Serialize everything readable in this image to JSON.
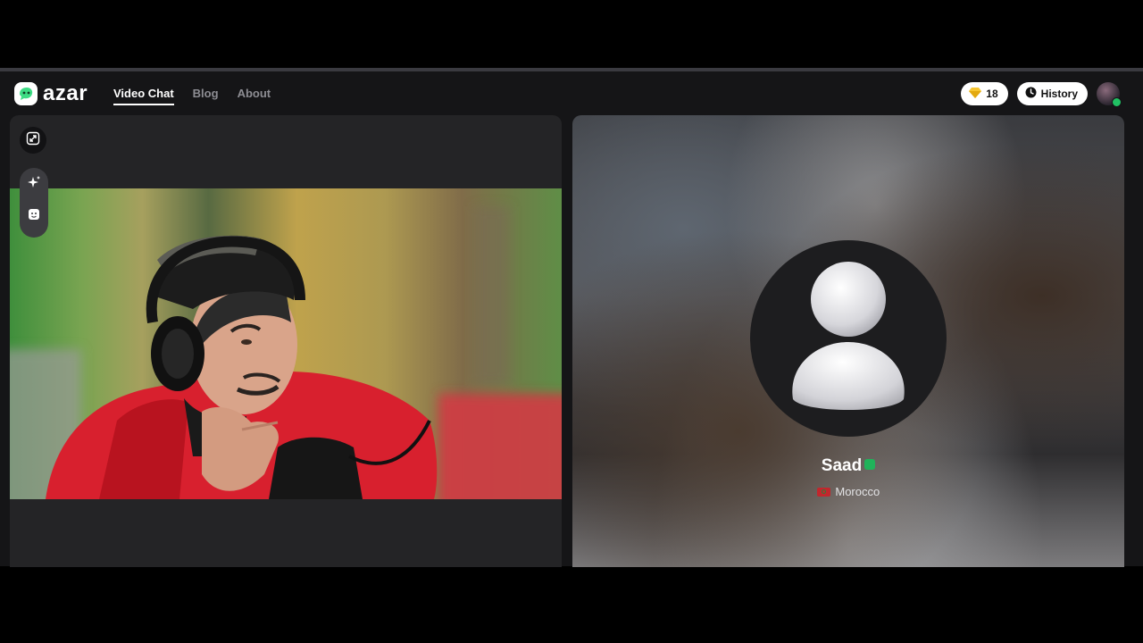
{
  "header": {
    "logo_text": "azar",
    "nav": [
      {
        "label": "Video Chat",
        "active": true
      },
      {
        "label": "Blog",
        "active": false
      },
      {
        "label": "About",
        "active": false
      }
    ],
    "gems": "18",
    "history_label": "History"
  },
  "partner": {
    "name": "Saad",
    "country": "Morocco"
  },
  "colors": {
    "app_background": "#151517",
    "panel_background": "#242426",
    "brand_green": "#3ddc84",
    "verified_green": "#20b25a",
    "gem_yellow": "#f7c631"
  },
  "icons": {
    "expand": "expand-icon",
    "effects": "sparkle-icon",
    "stickers": "smiley-icon",
    "gem": "gem-icon",
    "history": "clock-icon"
  }
}
